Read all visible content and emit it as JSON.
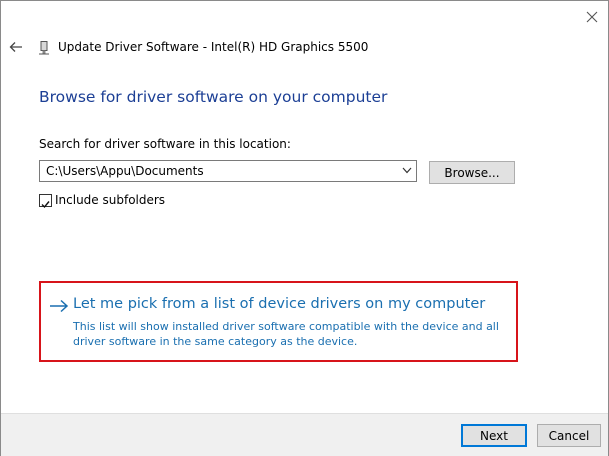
{
  "window": {
    "title": "Update Driver Software - Intel(R) HD Graphics 5500",
    "close_icon": "close-icon",
    "back_icon": "back-arrow-icon",
    "device_icon": "device-icon"
  },
  "main": {
    "heading": "Browse for driver software on your computer",
    "search_label": "Search for driver software in this location:",
    "path_value": "C:\\Users\\Appu\\Documents",
    "browse_label": "Browse...",
    "include_subfolders_label": "Include subfolders",
    "include_subfolders_checked": true,
    "pick_option": {
      "title": "Let me pick from a list of device drivers on my computer",
      "description": "This list will show installed driver software compatible with the device and all driver software in the same category as the device.",
      "highlight_color": "#d7141a"
    }
  },
  "footer": {
    "next_label": "Next",
    "cancel_label": "Cancel"
  },
  "colors": {
    "heading": "#1c3f95",
    "link": "#1a6fb0"
  }
}
